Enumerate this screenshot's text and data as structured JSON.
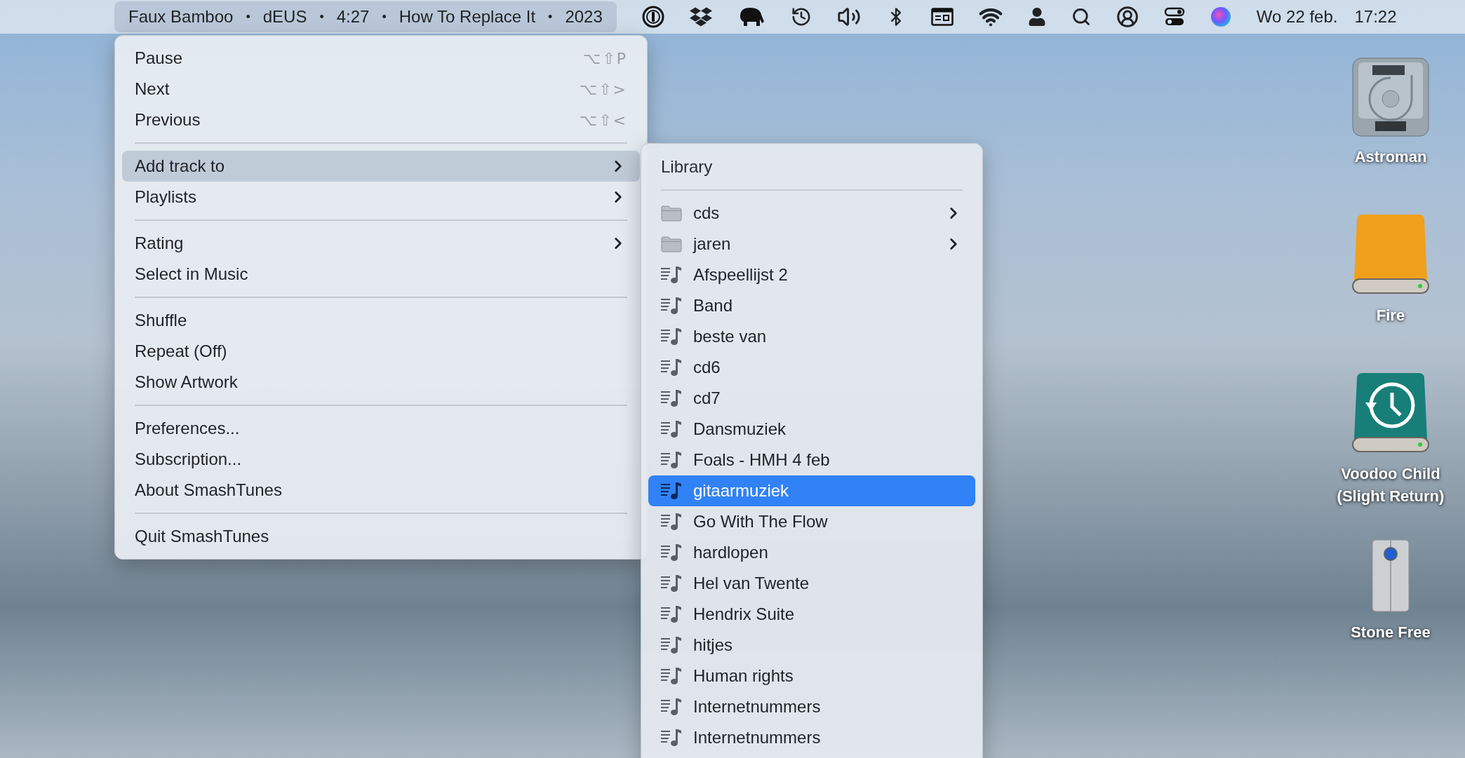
{
  "menu_bar": {
    "now_playing": {
      "separator": "•",
      "segments": [
        "Faux Bamboo",
        "dEUS",
        "4:27",
        "How To Replace It",
        "2023"
      ]
    },
    "clock": {
      "date": "Wo 22 feb.",
      "time": "17:22"
    }
  },
  "menu": {
    "items": [
      {
        "kind": "item",
        "label": "Pause",
        "shortcut": "⌥⇧P",
        "has_submenu": false,
        "selected": false
      },
      {
        "kind": "item",
        "label": "Next",
        "shortcut": "⌥⇧>",
        "has_submenu": false,
        "selected": false
      },
      {
        "kind": "item",
        "label": "Previous",
        "shortcut": "⌥⇧<",
        "has_submenu": false,
        "selected": false
      },
      {
        "kind": "separator"
      },
      {
        "kind": "item",
        "label": "Add track to",
        "has_submenu": true,
        "selected": true
      },
      {
        "kind": "item",
        "label": "Playlists",
        "has_submenu": true,
        "selected": false
      },
      {
        "kind": "separator"
      },
      {
        "kind": "item",
        "label": "Rating",
        "has_submenu": true,
        "selected": false
      },
      {
        "kind": "item",
        "label": "Select in Music",
        "has_submenu": false,
        "selected": false
      },
      {
        "kind": "separator"
      },
      {
        "kind": "item",
        "label": "Shuffle",
        "has_submenu": false,
        "selected": false
      },
      {
        "kind": "item",
        "label": "Repeat (Off)",
        "has_submenu": false,
        "selected": false
      },
      {
        "kind": "item",
        "label": "Show Artwork",
        "has_submenu": false,
        "selected": false
      },
      {
        "kind": "separator"
      },
      {
        "kind": "item",
        "label": "Preferences...",
        "has_submenu": false,
        "selected": false
      },
      {
        "kind": "item",
        "label": "Subscription...",
        "has_submenu": false,
        "selected": false
      },
      {
        "kind": "item",
        "label": "About SmashTunes",
        "has_submenu": false,
        "selected": false
      },
      {
        "kind": "separator"
      },
      {
        "kind": "item",
        "label": "Quit SmashTunes",
        "has_submenu": false,
        "selected": false
      }
    ]
  },
  "submenu": {
    "header": "Library",
    "items": [
      {
        "kind": "folder",
        "label": "cds",
        "has_submenu": true,
        "selected": false
      },
      {
        "kind": "folder",
        "label": "jaren",
        "has_submenu": true,
        "selected": false
      },
      {
        "kind": "playlist",
        "label": "Afspeellijst 2",
        "has_submenu": false,
        "selected": false
      },
      {
        "kind": "playlist",
        "label": "Band",
        "has_submenu": false,
        "selected": false
      },
      {
        "kind": "playlist",
        "label": "beste van",
        "has_submenu": false,
        "selected": false
      },
      {
        "kind": "playlist",
        "label": "cd6",
        "has_submenu": false,
        "selected": false
      },
      {
        "kind": "playlist",
        "label": "cd7",
        "has_submenu": false,
        "selected": false
      },
      {
        "kind": "playlist",
        "label": "Dansmuziek",
        "has_submenu": false,
        "selected": false
      },
      {
        "kind": "playlist",
        "label": "Foals - HMH 4 feb",
        "has_submenu": false,
        "selected": false
      },
      {
        "kind": "playlist",
        "label": "gitaarmuziek",
        "has_submenu": false,
        "selected": true
      },
      {
        "kind": "playlist",
        "label": "Go With The Flow",
        "has_submenu": false,
        "selected": false
      },
      {
        "kind": "playlist",
        "label": "hardlopen",
        "has_submenu": false,
        "selected": false
      },
      {
        "kind": "playlist",
        "label": "Hel van Twente",
        "has_submenu": false,
        "selected": false
      },
      {
        "kind": "playlist",
        "label": "Hendrix Suite",
        "has_submenu": false,
        "selected": false
      },
      {
        "kind": "playlist",
        "label": "hitjes",
        "has_submenu": false,
        "selected": false
      },
      {
        "kind": "playlist",
        "label": "Human rights",
        "has_submenu": false,
        "selected": false
      },
      {
        "kind": "playlist",
        "label": "Internetnummers",
        "has_submenu": false,
        "selected": false
      },
      {
        "kind": "playlist",
        "label": "Internetnummers",
        "has_submenu": false,
        "selected": false
      }
    ]
  },
  "desktop_icons": [
    {
      "kind": "hard-disk",
      "lines": [
        "Astroman"
      ]
    },
    {
      "kind": "orange-drive",
      "lines": [
        "Fire"
      ]
    },
    {
      "kind": "backup-drive",
      "lines": [
        "Voodoo Child",
        "(Slight Return)"
      ]
    },
    {
      "kind": "tower-drive",
      "lines": [
        "Stone Free"
      ]
    }
  ]
}
